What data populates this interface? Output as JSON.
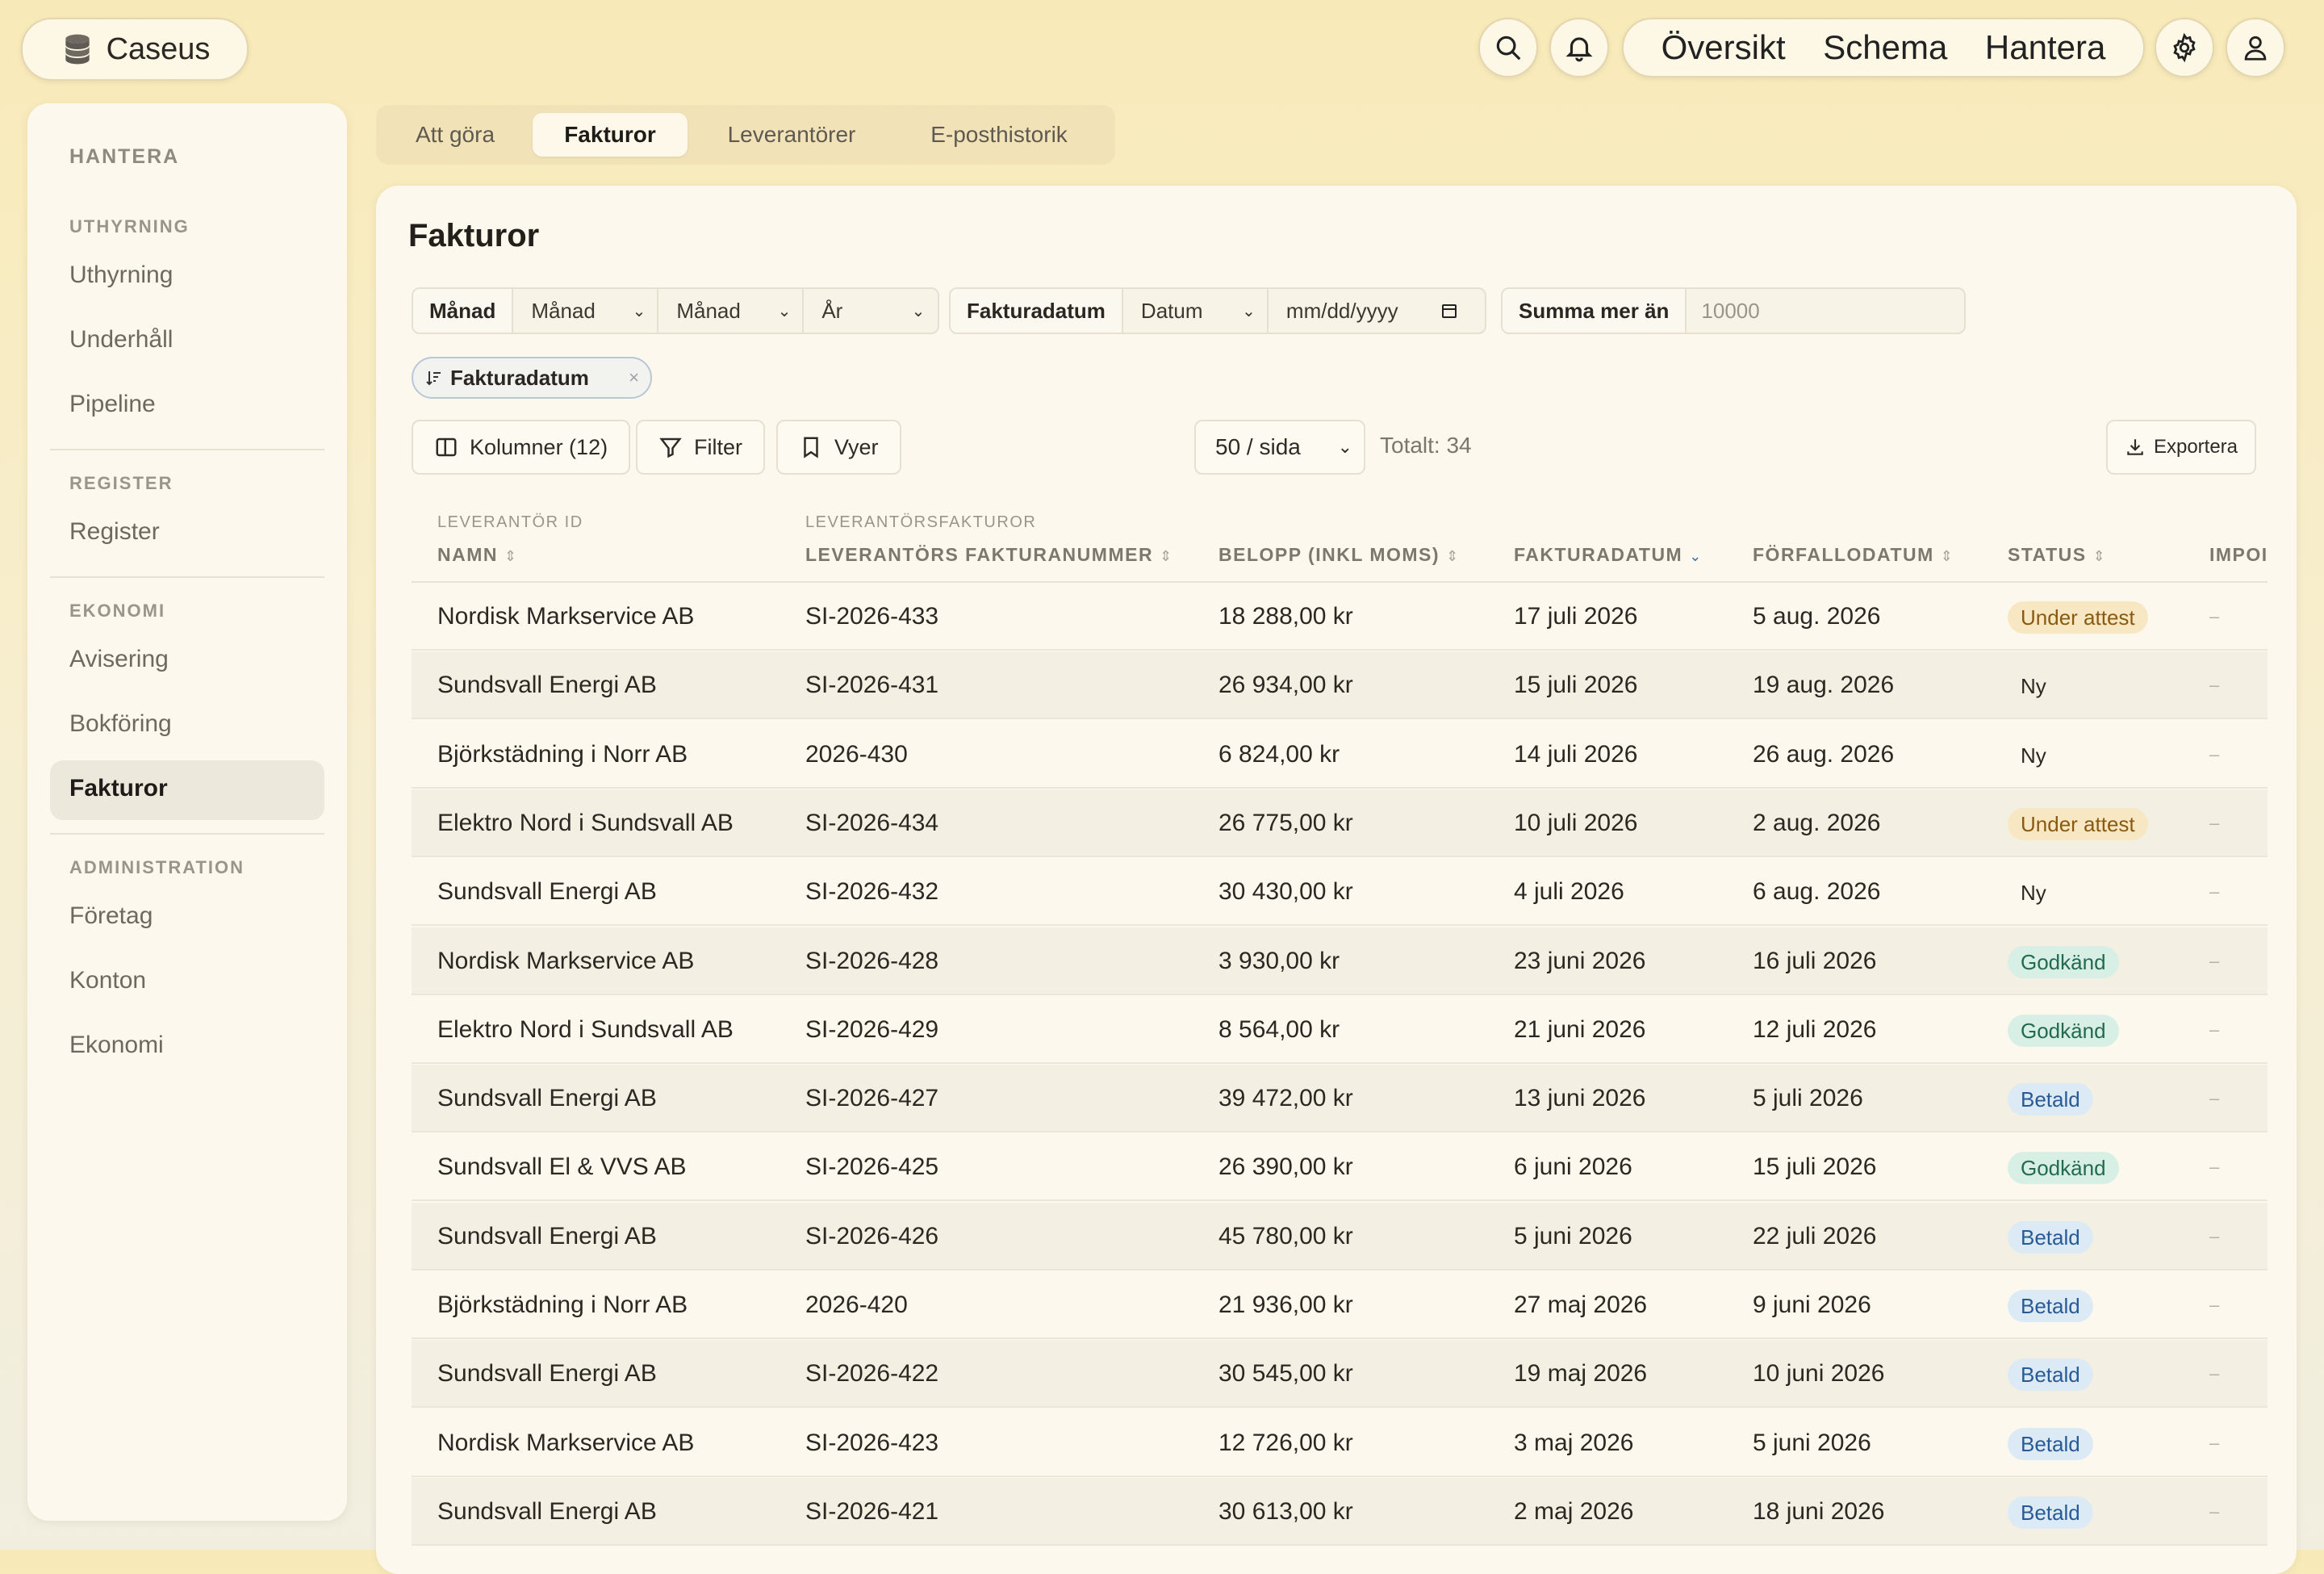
{
  "app": {
    "brand": "Caseus"
  },
  "topnav": {
    "items": [
      "Översikt",
      "Schema",
      "Hantera"
    ]
  },
  "sidebar": {
    "section": "HANTERA",
    "groups": {
      "uthyrning": "UTHYRNING",
      "register": "REGISTER",
      "ekonomi": "EKONOMI",
      "administration": "ADMINISTRATION"
    },
    "items": {
      "uthyrning": "Uthyrning",
      "underhall": "Underhåll",
      "pipeline": "Pipeline",
      "register": "Register",
      "avisering": "Avisering",
      "bokforing": "Bokföring",
      "fakturor": "Fakturor",
      "foretag": "Företag",
      "konton": "Konton",
      "ekonomi": "Ekonomi"
    }
  },
  "tabs": {
    "att_gora": "Att göra",
    "fakturor": "Fakturor",
    "leverantorer": "Leverantörer",
    "eposthistorik": "E-posthistorik"
  },
  "page": {
    "title": "Fakturor"
  },
  "filters": {
    "month_label": "Månad",
    "month_from": "Månad",
    "month_to": "Månad",
    "year": "År",
    "invoice_date_label": "Fakturadatum",
    "date_select": "Datum",
    "date_input_placeholder": "mm/dd/yyyy",
    "sum_label": "Summa mer än",
    "sum_placeholder": "10000"
  },
  "sort_chip": {
    "label": "Fakturadatum",
    "remove": "×"
  },
  "toolbar": {
    "columns": "Kolumner (12)",
    "filter": "Filter",
    "views": "Vyer",
    "per_page": "50 / sida",
    "total": "Totalt: 34",
    "export": "Exportera"
  },
  "table": {
    "headers": {
      "supplier_sup": "LEVERANTÖR ID",
      "name": "NAMN",
      "invoices_sup": "LEVERANTÖRSFAKTUROR",
      "invoice_number": "LEVERANTÖRS FAKTURANUMMER",
      "amount": "BELOPP (INKL MOMS)",
      "invoice_date": "FAKTURADATUM",
      "due_date": "FÖRFALLODATUM",
      "status": "STATUS",
      "import": "IMPOI"
    },
    "rows": [
      {
        "name": "Nordisk Markservice AB",
        "number": "SI-2026-433",
        "amount": "18 288,00 kr",
        "date": "17 juli 2026",
        "due": "5 aug. 2026",
        "status": "Under attest",
        "kind": "attest",
        "imp": "–"
      },
      {
        "name": "Sundsvall Energi AB",
        "number": "SI-2026-431",
        "amount": "26 934,00 kr",
        "date": "15 juli 2026",
        "due": "19 aug. 2026",
        "status": "Ny",
        "kind": "ny",
        "imp": "–"
      },
      {
        "name": "Björkstädning i Norr AB",
        "number": "2026-430",
        "amount": "6 824,00 kr",
        "date": "14 juli 2026",
        "due": "26 aug. 2026",
        "status": "Ny",
        "kind": "ny",
        "imp": "–"
      },
      {
        "name": "Elektro Nord i Sundsvall AB",
        "number": "SI-2026-434",
        "amount": "26 775,00 kr",
        "date": "10 juli 2026",
        "due": "2 aug. 2026",
        "status": "Under attest",
        "kind": "attest",
        "imp": "–"
      },
      {
        "name": "Sundsvall Energi AB",
        "number": "SI-2026-432",
        "amount": "30 430,00 kr",
        "date": "4 juli 2026",
        "due": "6 aug. 2026",
        "status": "Ny",
        "kind": "ny",
        "imp": "–"
      },
      {
        "name": "Nordisk Markservice AB",
        "number": "SI-2026-428",
        "amount": "3 930,00 kr",
        "date": "23 juni 2026",
        "due": "16 juli 2026",
        "status": "Godkänd",
        "kind": "godkand",
        "imp": "–"
      },
      {
        "name": "Elektro Nord i Sundsvall AB",
        "number": "SI-2026-429",
        "amount": "8 564,00 kr",
        "date": "21 juni 2026",
        "due": "12 juli 2026",
        "status": "Godkänd",
        "kind": "godkand",
        "imp": "–"
      },
      {
        "name": "Sundsvall Energi AB",
        "number": "SI-2026-427",
        "amount": "39 472,00 kr",
        "date": "13 juni 2026",
        "due": "5 juli 2026",
        "status": "Betald",
        "kind": "betald",
        "imp": "–"
      },
      {
        "name": "Sundsvall El & VVS AB",
        "number": "SI-2026-425",
        "amount": "26 390,00 kr",
        "date": "6 juni 2026",
        "due": "15 juli 2026",
        "status": "Godkänd",
        "kind": "godkand",
        "imp": "–"
      },
      {
        "name": "Sundsvall Energi AB",
        "number": "SI-2026-426",
        "amount": "45 780,00 kr",
        "date": "5 juni 2026",
        "due": "22 juli 2026",
        "status": "Betald",
        "kind": "betald",
        "imp": "–"
      },
      {
        "name": "Björkstädning i Norr AB",
        "number": "2026-420",
        "amount": "21 936,00 kr",
        "date": "27 maj 2026",
        "due": "9 juni 2026",
        "status": "Betald",
        "kind": "betald",
        "imp": "–"
      },
      {
        "name": "Sundsvall Energi AB",
        "number": "SI-2026-422",
        "amount": "30 545,00 kr",
        "date": "19 maj 2026",
        "due": "10 juni 2026",
        "status": "Betald",
        "kind": "betald",
        "imp": "–"
      },
      {
        "name": "Nordisk Markservice AB",
        "number": "SI-2026-423",
        "amount": "12 726,00 kr",
        "date": "3 maj 2026",
        "due": "5 juni 2026",
        "status": "Betald",
        "kind": "betald",
        "imp": "–"
      },
      {
        "name": "Sundsvall Energi AB",
        "number": "SI-2026-421",
        "amount": "30 613,00 kr",
        "date": "2 maj 2026",
        "due": "18 juni 2026",
        "status": "Betald",
        "kind": "betald",
        "imp": "–"
      }
    ]
  },
  "icons": {
    "brand": "database-stack-icon",
    "search": "search-icon",
    "notifications": "bell-icon",
    "settings": "gear-icon",
    "user": "user-icon",
    "columns": "columns-icon",
    "filter": "funnel-icon",
    "views": "bookmark-icon",
    "export": "download-icon",
    "sort": "sort-desc-icon"
  },
  "colors": {
    "accent_blue": "#3b6bb0",
    "status_attest_bg": "#f7e8c3",
    "status_godkand_bg": "#d7efe5",
    "status_betald_bg": "#dceaf6"
  }
}
